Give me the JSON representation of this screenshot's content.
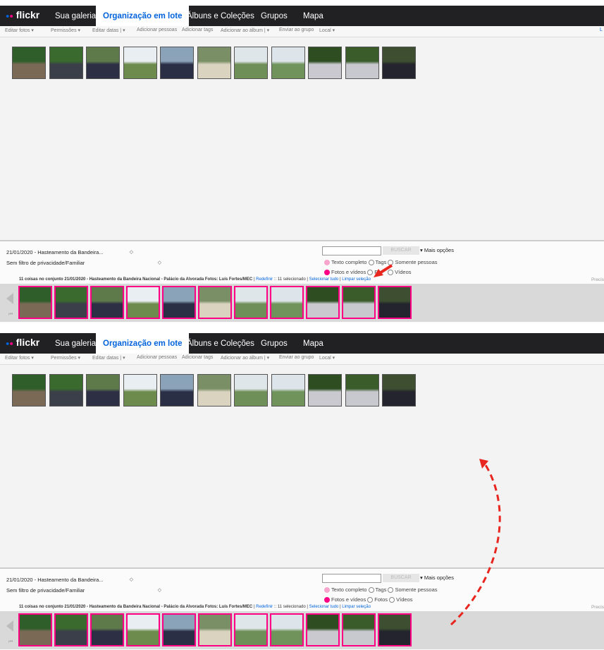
{
  "nav": {
    "logo": "flickr",
    "tabs": [
      "Sua galeria",
      "Organização em lote",
      "Álbuns e Coleções",
      "Grupos",
      "Mapa"
    ]
  },
  "menu": {
    "items": [
      "Editar fotos ▾",
      "Permissões ▾",
      "Editar datas | ▾",
      "Adicionar pessoas",
      "Adicionar tags",
      "Adicionar ao álbum | ▾",
      "Enviar ao grupo",
      "Local ▾"
    ],
    "right_cut": "L"
  },
  "bottom": {
    "set_select": "21/01/2020 - Hasteamento da Bandeira...",
    "privacy_select": "Sem filtro de privacidade/Familiar",
    "select_arrow": "◇",
    "search_button": "BUSCAR",
    "more_options": "▾ Mais opções",
    "radio_text_full": "Texto completo",
    "radio_tags": "Tags",
    "radio_people": "Somente pessoas",
    "radio_photos_videos": "Fotos e vídeos",
    "radio_photos": "Fotos",
    "radio_videos": "Vídeos",
    "info_count": "11 coisas no conjunto",
    "info_set": "21/01/2020 - Hasteamento da Bandeira Nacional - Palácio da Alvorada Fotos: Luís Fortes/MEC",
    "redefinir": "Redefinir",
    "selected": ":: 11 selecionado |",
    "select_all": "Selecionar tudo",
    "clear_selection": "Limpar seleção",
    "precis": "Precis"
  },
  "panel1": {
    "radio_photos_partial": "Fo"
  },
  "colors": {
    "accent": "#ff0084",
    "link": "#0063dc",
    "topbar": "#212124",
    "arrow": "#e8261f"
  },
  "thumbs": [
    {
      "top": "#2f5e2a",
      "bottom": "#7a6a55"
    },
    {
      "top": "#3a6a2d",
      "bottom": "#3b3f4a"
    },
    {
      "top": "#5f7a4a",
      "bottom": "#2d2f45"
    },
    {
      "top": "#e8eef2",
      "bottom": "#6c8b4c"
    },
    {
      "top": "#8aa3b8",
      "bottom": "#2a2f46"
    },
    {
      "top": "#7a8f66",
      "bottom": "#d9d3c0"
    },
    {
      "top": "#dfe6ea",
      "bottom": "#6e8f57"
    },
    {
      "top": "#dde5ea",
      "bottom": "#6f935a"
    },
    {
      "top": "#2e4e22",
      "bottom": "#c9c9cf"
    },
    {
      "top": "#3a5c2b",
      "bottom": "#c8c8cf"
    },
    {
      "top": "#3d4f30",
      "bottom": "#23242e"
    }
  ]
}
